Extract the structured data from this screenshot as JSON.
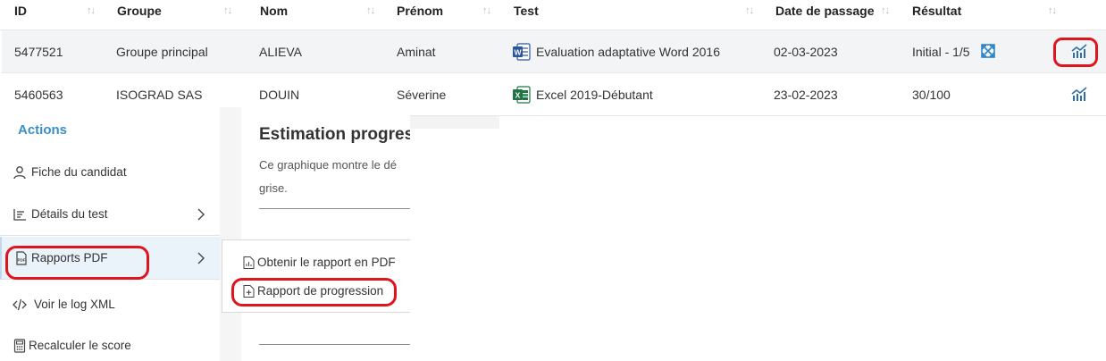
{
  "table": {
    "headers": {
      "id": "ID",
      "groupe": "Groupe",
      "nom": "Nom",
      "prenom": "Prénom",
      "test": "Test",
      "date": "Date de passage",
      "resultat": "Résultat"
    },
    "sort_glyph": "↑↓",
    "rows": [
      {
        "id": "5477521",
        "groupe": "Groupe principal",
        "nom": "ALIEVA",
        "prenom": "Aminat",
        "test_icon": "word-icon",
        "test": "Evaluation adaptative Word 2016",
        "date": "02-03-2023",
        "resultat": "Initial - 1/5"
      },
      {
        "id": "5460563",
        "groupe": "ISOGRAD SAS",
        "nom": "DOUIN",
        "prenom": "Séverine",
        "test_icon": "excel-icon",
        "test": "Excel 2019-Débutant",
        "date": "23-02-2023",
        "resultat": "30/100"
      }
    ]
  },
  "actions": {
    "title": "Actions",
    "items": [
      {
        "label": "Fiche du candidat",
        "icon": "user-icon"
      },
      {
        "label": "Détails du test",
        "icon": "list-chart-icon"
      },
      {
        "label": "Rapports PDF",
        "icon": "pdf-icon"
      },
      {
        "label": "Voir le log XML",
        "icon": "code-icon"
      },
      {
        "label": "Recalculer le score",
        "icon": "calculator-icon"
      }
    ]
  },
  "estimation": {
    "title": "Estimation progres",
    "description_line1": "Ce graphique montre le dé",
    "description_line2": "grise."
  },
  "submenu": {
    "items": [
      {
        "label": "Obtenir le rapport en PDF",
        "icon": "pdf-file-icon"
      },
      {
        "label": "Rapport de progression",
        "icon": "file-plus-icon"
      }
    ]
  },
  "colors": {
    "accent": "#3a8fc4",
    "highlight": "#e0141c",
    "word": "#2b579a",
    "excel": "#217346"
  }
}
